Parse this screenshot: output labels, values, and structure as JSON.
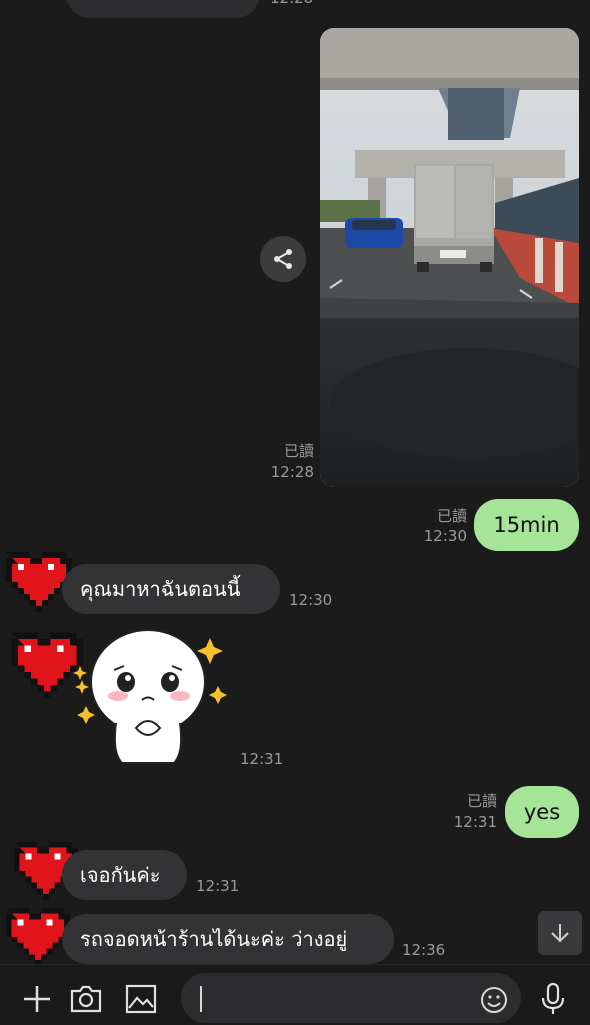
{
  "top_partial": {
    "time": "12:28"
  },
  "messages": {
    "photo_msg": {
      "read": "已讀",
      "time": "12:28"
    },
    "out_15min": {
      "text": "15min",
      "read": "已讀",
      "time": "12:30"
    },
    "in_1": {
      "text": "คุณมาหาฉันตอนนี้",
      "time": "12:30"
    },
    "sticker": {
      "time": "12:31"
    },
    "out_yes": {
      "text": "yes",
      "read": "已讀",
      "time": "12:31"
    },
    "in_2": {
      "text": "เจอกันค่ะ",
      "time": "12:31"
    },
    "in_3": {
      "text": "รถจอดหน้าร้านได้นะค่ะ ว่างอยู่",
      "time": "12:36"
    }
  },
  "colors": {
    "outgoing_bubble": "#a6e497",
    "incoming_bubble": "#333335",
    "background": "#1b1b1b"
  },
  "icons": [
    "share-icon",
    "scroll-down-icon",
    "plus-icon",
    "camera-icon",
    "image-icon",
    "emoji-icon",
    "microphone-icon"
  ]
}
